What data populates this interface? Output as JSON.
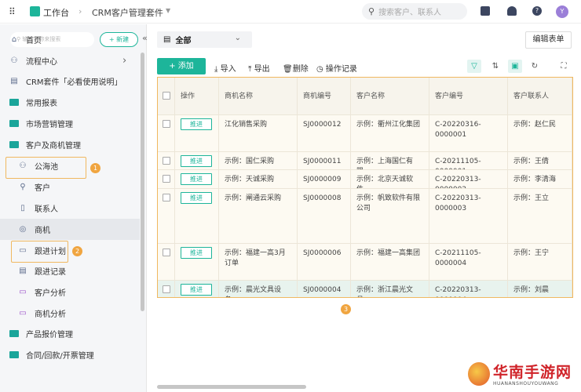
{
  "topbar": {
    "workspace": "工作台",
    "app": "CRM客户管理套件",
    "search_placeholder": "搜索客户、联系人",
    "avatar": "Y"
  },
  "sidebar": {
    "search_placeholder": "输入名称来搜索",
    "new_label": "+ 新建",
    "items": [
      {
        "label": "首页",
        "icon": "home-icon"
      },
      {
        "label": "流程中心",
        "icon": "workflow-icon"
      },
      {
        "label": "CRM套件「必看使用说明」",
        "icon": "document-icon"
      },
      {
        "label": "常用报表",
        "icon": "folder-icon"
      },
      {
        "label": "市场营销管理",
        "icon": "folder-icon"
      },
      {
        "label": "客户及商机管理",
        "icon": "folder-open-icon"
      },
      {
        "label": "公海池",
        "icon": "users-icon"
      },
      {
        "label": "客户",
        "icon": "user-icon"
      },
      {
        "label": "联系人",
        "icon": "contact-book-icon"
      },
      {
        "label": "商机",
        "icon": "opportunity-icon"
      },
      {
        "label": "跟进计划",
        "icon": "calendar-icon"
      },
      {
        "label": "跟进记录",
        "icon": "record-icon"
      },
      {
        "label": "客户分析",
        "icon": "chart-screen-icon"
      },
      {
        "label": "商机分析",
        "icon": "chart-screen-icon"
      },
      {
        "label": "产品报价管理",
        "icon": "folder-icon"
      },
      {
        "label": "合同/回款/开票管理",
        "icon": "folder-icon"
      }
    ]
  },
  "annotations": [
    "1",
    "2",
    "3"
  ],
  "main": {
    "view": "全部",
    "edit_form": "编辑表单",
    "add": "+ 添加",
    "import": "导入",
    "export": "导出",
    "delete": "删除",
    "log": "操作记录",
    "columns": [
      "操作",
      "商机名称",
      "商机编号",
      "客户名称",
      "客户编号",
      "客户联系人"
    ],
    "action_label": "推进",
    "rows": [
      [
        "江化销售采购",
        "SJ0000012",
        "示例：衢州江化集团",
        "C-20220316-0000001",
        "示例：赵仁民"
      ],
      [
        "示例：国仁采购",
        "SJ0000011",
        "示例：上海国仁有限...",
        "C-20211105-0000001",
        "示例：王倩"
      ],
      [
        "示例：天诚采购",
        "SJ0000009",
        "示例：北京天诚软件...",
        "C-20220313-0000002",
        "示例：李清海"
      ],
      [
        "示例：阐通云采购",
        "SJ0000008",
        "示例：帆致软件有限公司",
        "C-20220313-0000003",
        "示例：王立"
      ],
      [
        "示例：福建一高3月订单",
        "SJ0000006",
        "示例：福建一高集团",
        "C-20211105-0000004",
        "示例：王宁"
      ],
      [
        "示例：晨光文具设备...",
        "SJ0000004",
        "示例：浙江晨光文具...",
        "C-20220313-0000004",
        "示例：刘晨"
      ]
    ]
  },
  "watermark": {
    "title": "华南手游网",
    "subtitle": "HUANANSHOUYOUWANG"
  },
  "colors": {
    "accent": "#1db59a",
    "highlight": "#f0b860"
  }
}
